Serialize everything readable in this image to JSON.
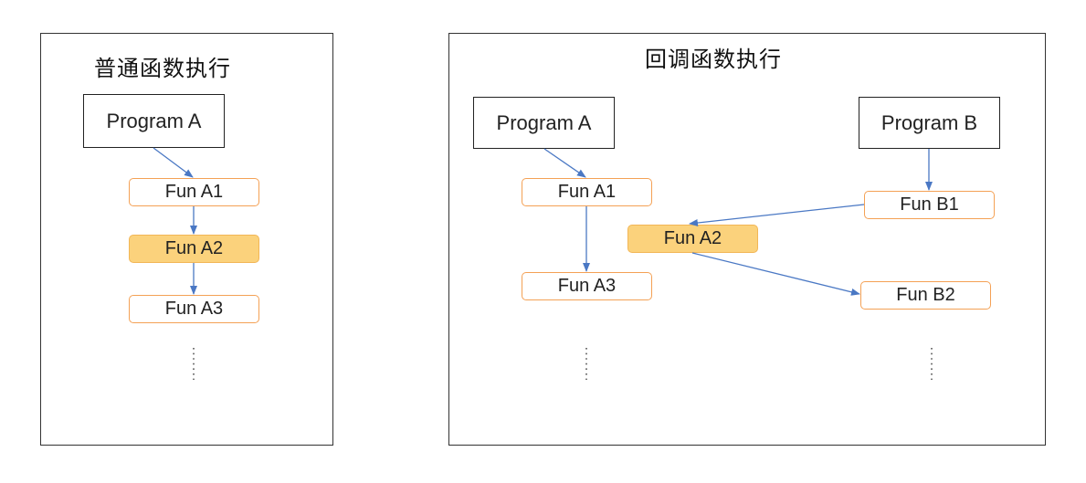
{
  "diagrams": [
    {
      "title": "普通函数执行",
      "program": "Program A",
      "functions": [
        "Fun A1",
        "Fun A2",
        "Fun A3"
      ],
      "highlighted": "Fun A2"
    },
    {
      "title": "回调函数执行",
      "program_a": "Program A",
      "program_b": "Program B",
      "functions_a": [
        "Fun A1",
        "Fun A3"
      ],
      "callback": "Fun A2",
      "functions_b": [
        "Fun B1",
        "Fun B2"
      ],
      "highlighted": "Fun A2"
    }
  ],
  "colors": {
    "arrow": "#4a78c4",
    "node_border": "#f4a155",
    "highlight_fill": "#fbd27c"
  }
}
